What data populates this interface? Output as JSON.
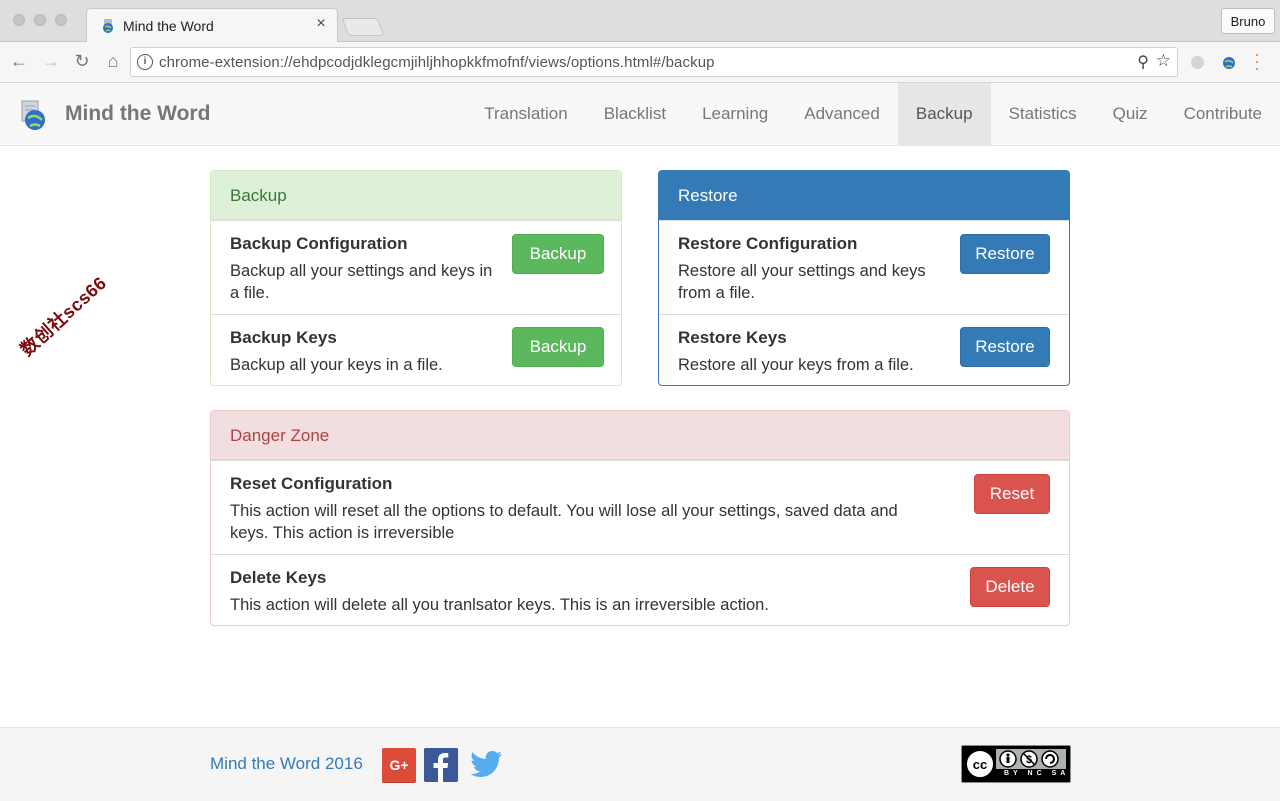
{
  "browser": {
    "tab_title": "Mind the Word",
    "tab_close": "×",
    "profile_name": "Bruno",
    "url": "chrome-extension://ehdpcodjdklegcmjihljhhopkkfmofnf/views/options.html#/backup"
  },
  "app": {
    "brand": "Mind the Word",
    "nav": [
      "Translation",
      "Blacklist",
      "Learning",
      "Advanced",
      "Backup",
      "Statistics",
      "Quiz",
      "Contribute"
    ],
    "active_nav": "Backup"
  },
  "backup_panel": {
    "heading": "Backup",
    "rows": [
      {
        "title": "Backup Configuration",
        "desc_line1": "Backup all your settings and keys in",
        "desc_line2": "a file.",
        "button": "Backup"
      },
      {
        "title": "Backup Keys",
        "desc_line1": "Backup all your keys in a file.",
        "desc_line2": "",
        "button": "Backup"
      }
    ]
  },
  "restore_panel": {
    "heading": "Restore",
    "rows": [
      {
        "title": "Restore Configuration",
        "desc_line1": "Restore all your settings and keys",
        "desc_line2": "from a file.",
        "button": "Restore"
      },
      {
        "title": "Restore Keys",
        "desc_line1": "Restore all your keys from a file.",
        "desc_line2": "",
        "button": "Restore"
      }
    ]
  },
  "danger_panel": {
    "heading": "Danger Zone",
    "rows": [
      {
        "title": "Reset Configuration",
        "desc_line1": "This action will reset all the options to default. You will lose all your settings, saved data and",
        "desc_line2": "keys. This action is irreversible",
        "button": "Reset"
      },
      {
        "title": "Delete Keys",
        "desc_line1": "This action will delete all you tranlsator keys. This is an irreversible action.",
        "desc_line2": "",
        "button": "Delete"
      }
    ]
  },
  "footer": {
    "text": "Mind the Word 2016",
    "gplus_label": "G+",
    "license_text": "BY NC SA"
  },
  "watermark": "数创社scs66",
  "colors": {
    "success": "#5cb85c",
    "primary": "#337ab7",
    "danger": "#d9534f"
  }
}
